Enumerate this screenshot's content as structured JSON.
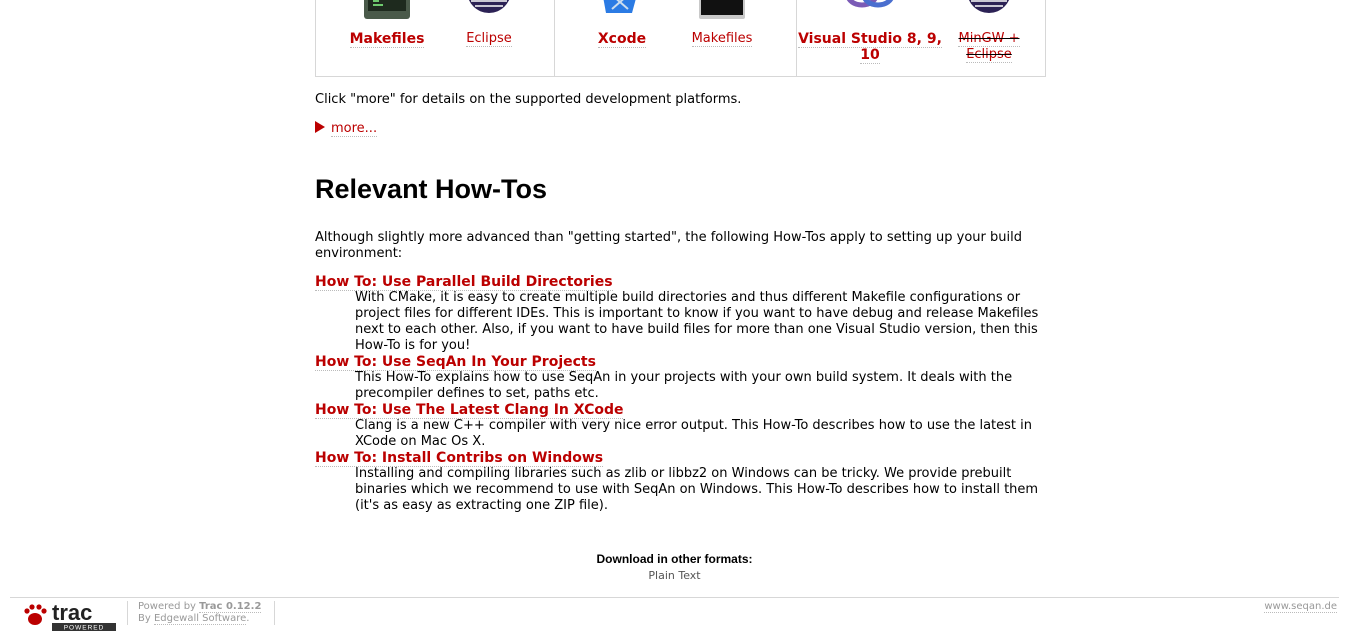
{
  "platforms": [
    {
      "label": "Makefiles",
      "style": "bold",
      "icon": "terminal-icon"
    },
    {
      "label": "Eclipse",
      "style": "normal",
      "icon": "eclipse-icon"
    },
    {
      "label": "Xcode",
      "style": "bold",
      "icon": "xcode-icon"
    },
    {
      "label": "Makefiles",
      "style": "normal",
      "icon": "terminal-icon"
    },
    {
      "label": "Visual Studio 8, 9, 10",
      "style": "bold",
      "icon": "visual-studio-icon"
    },
    {
      "label": "MinGW + Eclipse",
      "style": "strike",
      "icon": "eclipse-icon"
    }
  ],
  "intro": "Click \"more\" for details on the supported development platforms.",
  "more_label": "more...",
  "howto": {
    "title": "Relevant How-Tos",
    "lead": "Although slightly more advanced than \"getting started\", the following How-Tos apply to setting up your build environment:",
    "items": [
      {
        "title": "How To: Use Parallel Build Directories",
        "text": "With CMake, it is easy to create multiple build directories and thus different Makefile configurations or project files for different IDEs. This is important to know if you want to have debug and release Makefiles next to each other. Also, if you want to have build files for more than one Visual Studio version, then this How-To is for you!"
      },
      {
        "title": "How To: Use SeqAn In Your Projects",
        "text": "This How-To explains how to use SeqAn in your projects with your own build system. It deals with the precompiler defines to set, paths etc."
      },
      {
        "title": "How To: Use The Latest Clang In XCode",
        "text": "Clang is a new C++ compiler with very nice error output. This How-To describes how to use the latest in XCode on Mac Os X."
      },
      {
        "title": "How To: Install Contribs on Windows",
        "text": "Installing and compiling libraries such as zlib or libbz2 on Windows can be tricky. We provide prebuilt binaries which we recommend to use with SeqAn on Windows. This How-To describes how to install them (it's as easy as extracting one ZIP file)."
      }
    ]
  },
  "download": {
    "header": "Download in other formats:",
    "format": "Plain Text"
  },
  "footer": {
    "logo_text": "trac",
    "logo_sub": "POWERED",
    "powered_prefix": "Powered by",
    "powered_name": "Trac 0.12.2",
    "by_prefix": "By",
    "by_name": "Edgewall Software",
    "site": "www.seqan.de"
  },
  "colors": {
    "link": "#bb0000",
    "border": "#d7d7d7"
  }
}
